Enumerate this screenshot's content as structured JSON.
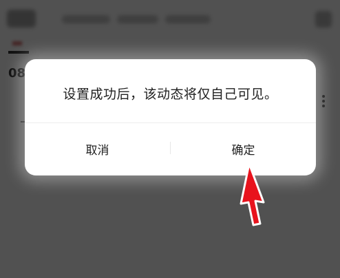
{
  "background": {
    "date_partial": "08"
  },
  "dialog": {
    "message": "设置成功后，该动态将仅自己可见。",
    "cancel_label": "取消",
    "confirm_label": "确定"
  },
  "annotation": {
    "arrow_color": "#e8131d",
    "arrow_target": "confirm-button"
  }
}
